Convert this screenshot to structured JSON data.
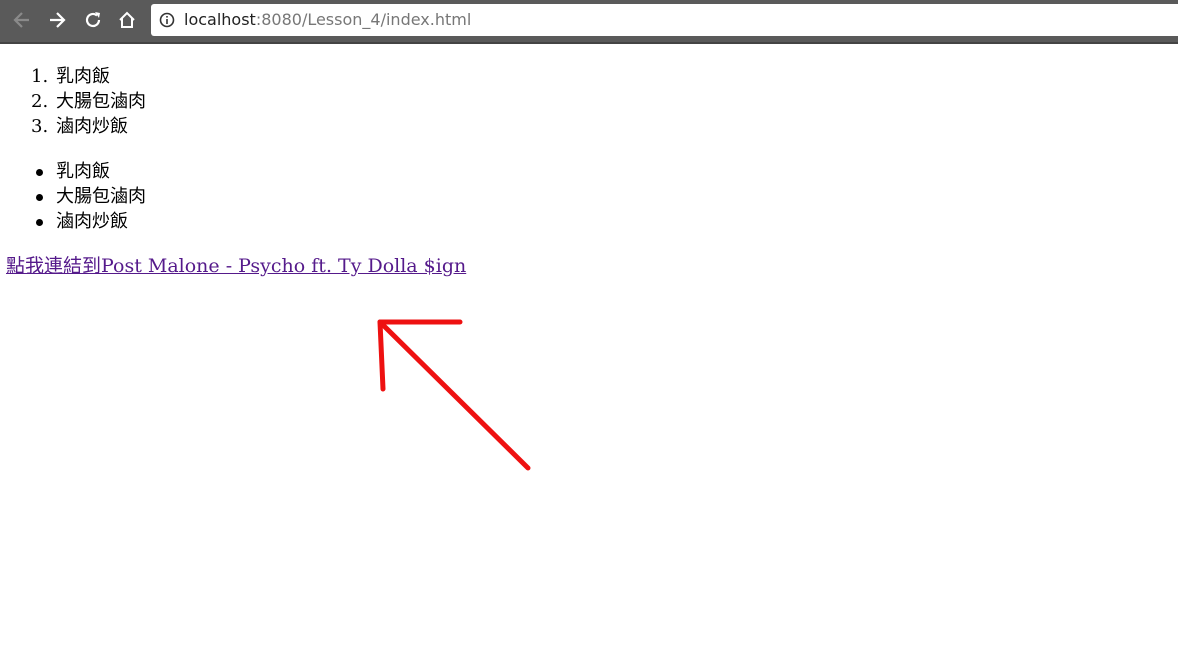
{
  "browser": {
    "url_host": "localhost",
    "url_rest": ":8080/Lesson_4/index.html"
  },
  "page": {
    "ordered_list": [
      {
        "num": "1.",
        "text": "乳肉飯"
      },
      {
        "num": "2.",
        "text": "大腸包滷肉"
      },
      {
        "num": "3.",
        "text": "滷肉炒飯"
      }
    ],
    "unordered_list": [
      {
        "text": "乳肉飯"
      },
      {
        "text": "大腸包滷肉"
      },
      {
        "text": "滷肉炒飯"
      }
    ],
    "link_text": "點我連結到Post Malone - Psycho ft. Ty Dolla $ign"
  },
  "colors": {
    "visited_link": "#551a8b",
    "annotation_arrow": "#ee1111",
    "toolbar": "#5a5a5a"
  },
  "icons": [
    "back-arrow-icon",
    "forward-arrow-icon",
    "reload-icon",
    "home-icon",
    "info-icon"
  ]
}
